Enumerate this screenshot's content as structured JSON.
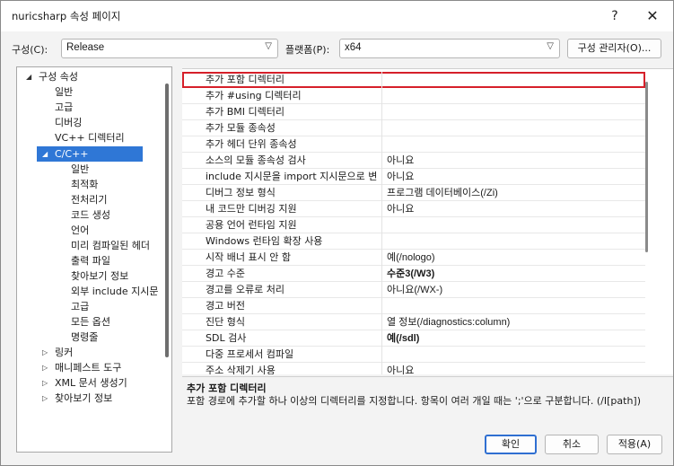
{
  "window": {
    "title": "nuricsharp 속성 페이지",
    "help": "?",
    "close": "✕"
  },
  "config": {
    "label": "구성(C):",
    "value": "Release",
    "platform_label": "플랫폼(P):",
    "platform_value": "x64",
    "manager_button": "구성 관리자(O)..."
  },
  "tree": [
    {
      "label": "구성 속성",
      "toggle": "◢"
    },
    {
      "label": "일반"
    },
    {
      "label": "고급"
    },
    {
      "label": "디버깅"
    },
    {
      "label": "VC++ 디렉터리"
    },
    {
      "label": "C/C++",
      "toggle": "◢",
      "selected": true
    },
    {
      "label": "일반"
    },
    {
      "label": "최적화"
    },
    {
      "label": "전처리기"
    },
    {
      "label": "코드 생성"
    },
    {
      "label": "언어"
    },
    {
      "label": "미리 컴파일된 헤더"
    },
    {
      "label": "출력 파일"
    },
    {
      "label": "찾아보기 정보"
    },
    {
      "label": "외부 include 지시문"
    },
    {
      "label": "고급"
    },
    {
      "label": "모든 옵션"
    },
    {
      "label": "명령줄"
    },
    {
      "label": "링커",
      "toggle": "▷"
    },
    {
      "label": "매니페스트 도구",
      "toggle": "▷"
    },
    {
      "label": "XML 문서 생성기",
      "toggle": "▷"
    },
    {
      "label": "찾아보기 정보",
      "toggle": "▷"
    }
  ],
  "properties": [
    {
      "name": "추가 포함 디렉터리",
      "value": ""
    },
    {
      "name": "추가 #using 디렉터리",
      "value": ""
    },
    {
      "name": "추가 BMI 디렉터리",
      "value": ""
    },
    {
      "name": "추가 모듈 종속성",
      "value": ""
    },
    {
      "name": "추가 헤더 단위 종속성",
      "value": ""
    },
    {
      "name": "소스의 모듈 종속성 검사",
      "value": "아니요"
    },
    {
      "name": "include 지시문을 import 지시문으로 변",
      "value": "아니요"
    },
    {
      "name": "디버그 정보 형식",
      "value": "프로그램 데이터베이스(/Zi)"
    },
    {
      "name": "내 코드만 디버깅 지원",
      "value": "아니요"
    },
    {
      "name": "공용 언어 런타임 지원",
      "value": ""
    },
    {
      "name": "Windows 런타임 확장 사용",
      "value": ""
    },
    {
      "name": "시작 배너 표시 안 함",
      "value": "예(/nologo)"
    },
    {
      "name": "경고 수준",
      "value": "수준3(/W3)",
      "bold": true
    },
    {
      "name": "경고를 오류로 처리",
      "value": "아니요(/WX-)"
    },
    {
      "name": "경고 버전",
      "value": ""
    },
    {
      "name": "진단 형식",
      "value": "열 정보(/diagnostics:column)"
    },
    {
      "name": "SDL 검사",
      "value": "예(/sdl)",
      "bold": true
    },
    {
      "name": "다중 프로세서 컴파일",
      "value": ""
    },
    {
      "name": "주소 삭제기 사용",
      "value": "아니요"
    }
  ],
  "description": {
    "title": "추가 포함 디렉터리",
    "text": "포함 경로에 추가할 하나 이상의 디렉터리를 지정합니다. 항목이 여러 개일 때는 ';'으로 구분합니다. (/I[path])"
  },
  "buttons": {
    "ok": "확인",
    "cancel": "취소",
    "apply": "적용(A)"
  },
  "colors": {
    "selection": "#2f77d6",
    "highlight_box": "#d6202a"
  }
}
